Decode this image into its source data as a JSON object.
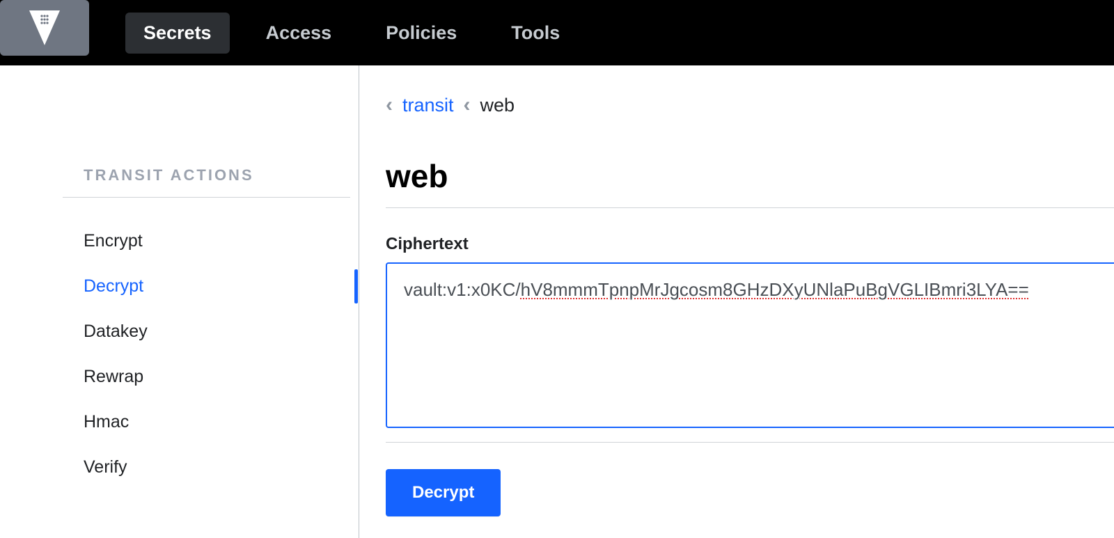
{
  "nav": {
    "items": [
      {
        "label": "Secrets",
        "active": true
      },
      {
        "label": "Access",
        "active": false
      },
      {
        "label": "Policies",
        "active": false
      },
      {
        "label": "Tools",
        "active": false
      }
    ]
  },
  "sidebar": {
    "title": "TRANSIT ACTIONS",
    "items": [
      {
        "label": "Encrypt",
        "active": false
      },
      {
        "label": "Decrypt",
        "active": true
      },
      {
        "label": "Datakey",
        "active": false
      },
      {
        "label": "Rewrap",
        "active": false
      },
      {
        "label": "Hmac",
        "active": false
      },
      {
        "label": "Verify",
        "active": false
      }
    ]
  },
  "breadcrumb": {
    "parent": "transit",
    "current": "web"
  },
  "page": {
    "title": "web",
    "field_label": "Ciphertext",
    "ciphertext_prefix": "vault:v1:x0KC/",
    "ciphertext_rest": "hV8mmmTpnpMrJgcosm8GHzDXyUNlaPuBgVGLIBmri3LYA==",
    "button_label": "Decrypt"
  }
}
